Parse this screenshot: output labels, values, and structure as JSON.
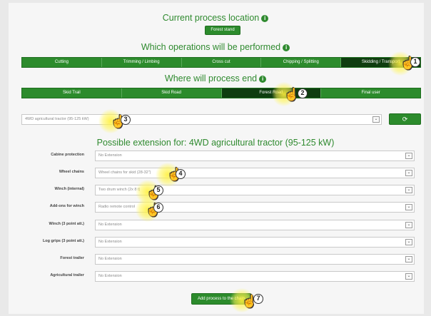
{
  "location": {
    "title": "Current process location",
    "button": "Forest stand"
  },
  "operations": {
    "title": "Which operations will be performed",
    "tabs": [
      "Cutting",
      "Trimming / Limbing",
      "Cross cut",
      "Chipping / Splitting",
      "Skidding / Transport"
    ],
    "active": "Skidding / Transport"
  },
  "process_end": {
    "title": "Where will process end",
    "tabs": [
      "Skid Trail",
      "Skid Road",
      "Forest Road",
      "Final user"
    ],
    "active": "Forest Road"
  },
  "machine": {
    "value": "4WD agricultural tractor (95-125 kW)",
    "refresh_icon": "refresh-icon"
  },
  "extension": {
    "title": "Possible extension for: 4WD agricultural tractor (95-125 kW)",
    "rows": [
      {
        "label": "Cabine protection",
        "value": "No Extension"
      },
      {
        "label": "Wheel chains",
        "value": "Wheel chains for skid (28-32\")"
      },
      {
        "label": "Winch (internal)",
        "value": "Two drum winch (2x 8 t)"
      },
      {
        "label": "Add-ons for winch",
        "value": "Radio remote control"
      },
      {
        "label": "Winch (3 point att.)",
        "value": "No Extension"
      },
      {
        "label": "Log grips (3 point att.)",
        "value": "No Extension"
      },
      {
        "label": "Forest trailer",
        "value": "No Extension"
      },
      {
        "label": "Agricultural trailer",
        "value": "No Extension"
      }
    ]
  },
  "add_button": "Add process to the chain",
  "steps": [
    "1",
    "2",
    "3",
    "4",
    "5",
    "6",
    "7"
  ],
  "colors": {
    "brand": "#2c8b2c",
    "active_tab": "#0f3d10",
    "highlight": "#fff03c"
  }
}
